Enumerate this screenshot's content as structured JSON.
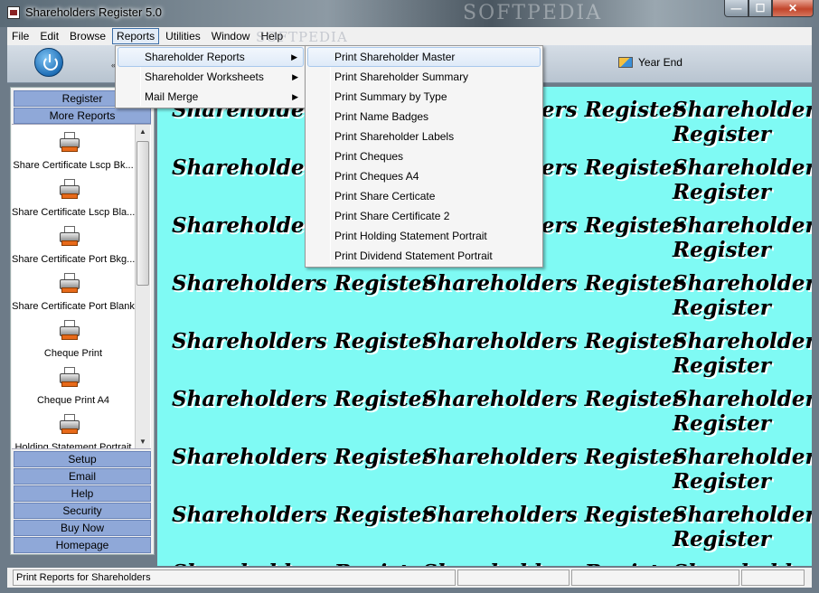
{
  "window": {
    "title": "Shareholders Register 5.0",
    "watermark": "SOFTPEDIA",
    "watermark_small": "www.softpedia.com",
    "controls": {
      "minimize": "—",
      "maximize": "☐",
      "close": "✕"
    }
  },
  "menubar": {
    "items": [
      "File",
      "Edit",
      "Browse",
      "Reports",
      "Utilities",
      "Window",
      "Help"
    ],
    "active": "Reports"
  },
  "toolbar": {
    "tb_dot": "«",
    "year_end_label": "Year End"
  },
  "reports_menu": {
    "items": [
      {
        "label": "Shareholder Reports",
        "arrow": "▶"
      },
      {
        "label": "Shareholder Worksheets",
        "arrow": "▶"
      },
      {
        "label": "Mail Merge",
        "arrow": "▶"
      }
    ]
  },
  "shareholder_reports_submenu": {
    "items": [
      "Print Shareholder Master",
      "Print Shareholder Summary",
      "Print Summary by Type",
      "Print Name Badges",
      "Print Shareholder Labels",
      "Print Cheques",
      "Print Cheques A4",
      "Print Share Certicate",
      "Print Share Certificate 2",
      "Print Holding Statement Portrait",
      "Print Dividend Statement Portrait"
    ],
    "highlighted": "Print Shareholder Master"
  },
  "left_panel": {
    "headers": [
      "Register",
      "More Reports"
    ],
    "reports": [
      "Share Certificate Lscp Bk...",
      "Share Certificate Lscp Bla...",
      "Share Certificate Port Bkg...",
      "Share Certificate Port Blank",
      "Cheque Print",
      "Cheque Print A4",
      "Holding Statement Portrait"
    ],
    "buttons": [
      "Setup",
      "Email",
      "Help",
      "Security",
      "Buy Now",
      "Homepage"
    ],
    "scroll_up": "▲",
    "scroll_down": "▼"
  },
  "main": {
    "background_text": "Shareholders Register",
    "background_color": "#7ffaf4"
  },
  "statusbar": {
    "message": "Print Reports for Shareholders"
  }
}
